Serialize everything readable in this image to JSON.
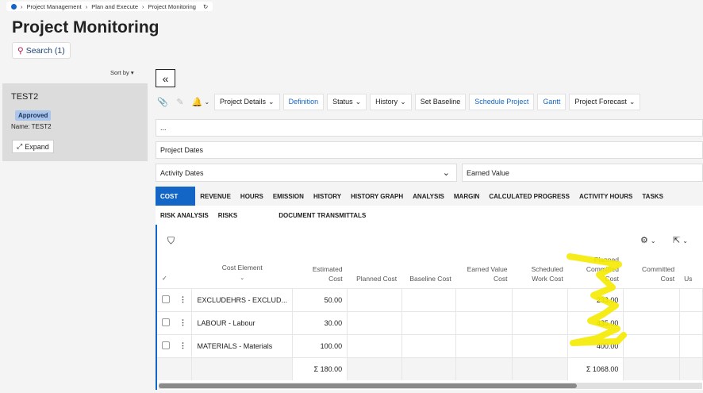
{
  "breadcrumb": {
    "items": [
      "Project Management",
      "Plan and Execute",
      "Project Monitoring"
    ]
  },
  "page_title": "Project Monitoring",
  "search_label": "Search (1)",
  "sort_label": "Sort by",
  "project_card": {
    "name": "TEST2",
    "status": "Approved",
    "name_line": "Name:  TEST2",
    "expand_label": "Expand"
  },
  "toolbar": {
    "project_details": "Project Details",
    "definition": "Definition",
    "status": "Status",
    "history": "History",
    "set_baseline": "Set Baseline",
    "schedule_project": "Schedule Project",
    "gantt": "Gantt",
    "project_forecast": "Project Forecast"
  },
  "ellipsis": "...",
  "project_dates": "Project Dates",
  "activity_dates": "Activity Dates",
  "earned_value": "Earned Value",
  "tabs_row1": [
    "COST",
    "REVENUE",
    "HOURS",
    "EMISSION",
    "HISTORY",
    "HISTORY GRAPH",
    "ANALYSIS",
    "MARGIN",
    "CALCULATED PROGRESS",
    "ACTIVITY HOURS",
    "TASKS"
  ],
  "tabs_row2": [
    "RISK ANALYSIS",
    "RISKS",
    "DOCUMENT TRANSMITTALS"
  ],
  "table": {
    "headers": {
      "cost_element": "Cost Element",
      "estimated_cost": "Estimated Cost",
      "planned_cost": "Planned Cost",
      "baseline_cost": "Baseline Cost",
      "earned_value_cost": "Earned Value Cost",
      "scheduled_work_cost": "Scheduled Work Cost",
      "planned_committed_cost": "Planned Committed Cost",
      "committed_cost": "Committed Cost",
      "next": "Us"
    },
    "rows": [
      {
        "cost_element": "EXCLUDEHRS - EXCLUD...",
        "estimated": "50.00",
        "planned_committed": "233.00"
      },
      {
        "cost_element": "LABOUR - Labour",
        "estimated": "30.00",
        "planned_committed": "435.00"
      },
      {
        "cost_element": "MATERIALS - Materials",
        "estimated": "100.00",
        "planned_committed": "400.00"
      }
    ],
    "totals": {
      "estimated": "Σ 180.00",
      "planned_committed": "Σ 1068.00"
    }
  },
  "colors": {
    "accent": "#1366c6",
    "highlight": "#f5ea00"
  }
}
